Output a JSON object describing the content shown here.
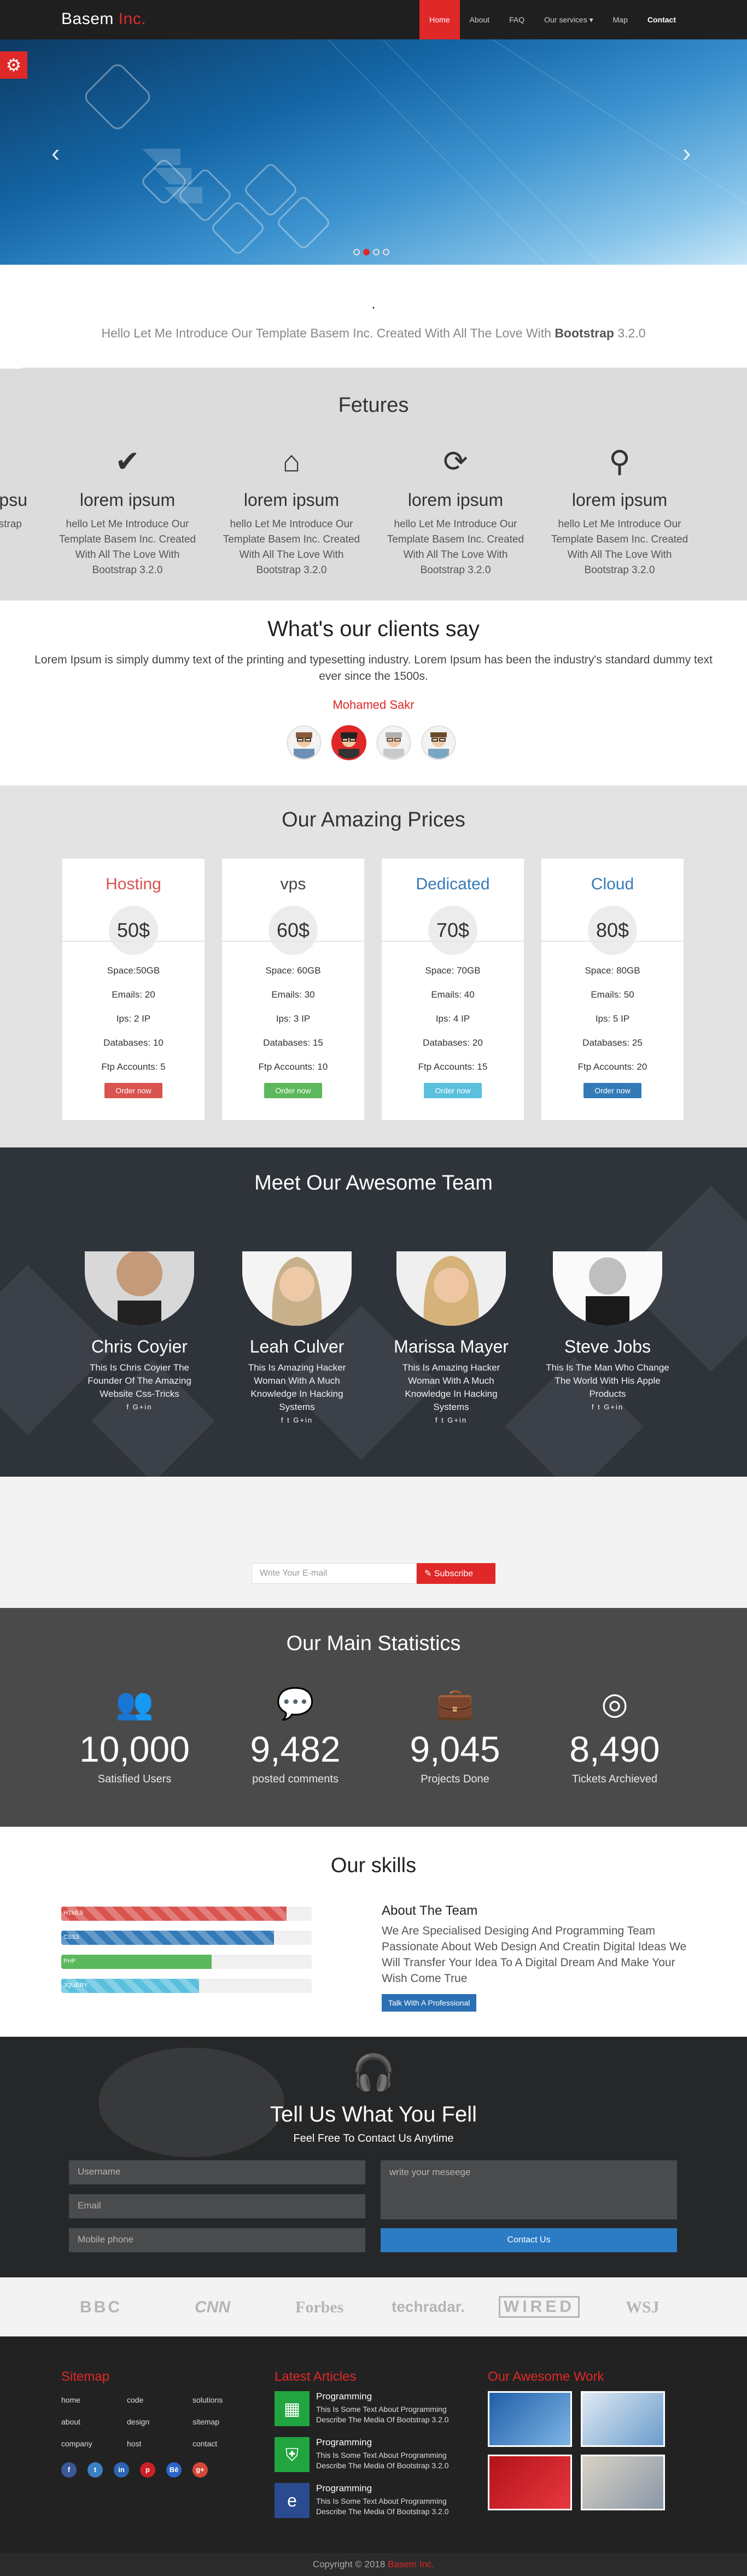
{
  "nav": {
    "brand_main": "Basem",
    "brand_accent": "Inc.",
    "items": [
      {
        "label": "Home",
        "active": true
      },
      {
        "label": "About"
      },
      {
        "label": "FAQ"
      },
      {
        "label": "Our services ▾"
      },
      {
        "label": "Map"
      },
      {
        "label": "Contact"
      }
    ]
  },
  "hero": {
    "slides": 4,
    "active_slide": 2
  },
  "intro": {
    "dot": ".",
    "text_before": "Hello Let Me Introduce Our Template Basem Inc. Created With All The Love With",
    "text_bold": "Bootstrap",
    "text_after": "3.2.0"
  },
  "features": {
    "title": "Fetures",
    "cut_title": "ipsu",
    "cut_desc": "Introdu Basem All The strap",
    "items": [
      {
        "icon": "check-icon",
        "glyph": "✔",
        "title": "lorem ipsum",
        "desc": "hello Let Me Introduce Our Template Basem Inc. Created With All The Love With Bootstrap 3.2.0"
      },
      {
        "icon": "home-icon",
        "glyph": "⌂",
        "title": "lorem ipsum",
        "desc": "hello Let Me Introduce Our Template Basem Inc. Created With All The Love With Bootstrap 3.2.0"
      },
      {
        "icon": "refresh-icon",
        "glyph": "⟳",
        "title": "lorem ipsum",
        "desc": "hello Let Me Introduce Our Template Basem Inc. Created With All The Love With Bootstrap 3.2.0"
      },
      {
        "icon": "search-icon",
        "glyph": "⚲",
        "title": "lorem ipsum",
        "desc": "hello Let Me Introduce Our Template Basem Inc. Created With All The Love With Bootstrap 3.2.0"
      }
    ]
  },
  "clients": {
    "title": "What's our clients say",
    "quote": "Lorem Ipsum is simply dummy text of the printing and typesetting industry. Lorem Ipsum has been the industry's standard dummy text ever since the 1500s.",
    "author": "Mohamed Sakr",
    "avatars": 4,
    "selected": 1
  },
  "prices": {
    "title": "Our Amazing Prices",
    "plans": [
      {
        "name": "Hosting",
        "price": "50$",
        "space": "Space:50GB",
        "emails": "Emails: 20",
        "ips": "Ips: 2 IP",
        "db": "Databases: 10",
        "ftp": "Ftp Accounts: 5",
        "button": "Order now",
        "color": "#d9534f"
      },
      {
        "name": "vps",
        "price": "60$",
        "space": "Space: 60GB",
        "emails": "Emails: 30",
        "ips": "Ips: 3 IP",
        "db": "Databases: 15",
        "ftp": "Ftp Accounts: 10",
        "button": "Order now",
        "color": "#5cb85c"
      },
      {
        "name": "Dedicated",
        "price": "70$",
        "space": "Space: 70GB",
        "emails": "Emails: 40",
        "ips": "Ips: 4 IP",
        "db": "Databases: 20",
        "ftp": "Ftp Accounts: 15",
        "button": "Order now",
        "color": "#5bc0de"
      },
      {
        "name": "Cloud",
        "price": "80$",
        "space": "Space: 80GB",
        "emails": "Emails: 50",
        "ips": "Ips: 5 IP",
        "db": "Databases: 25",
        "ftp": "Ftp Accounts: 20",
        "button": "Order now",
        "color": "#337ab7"
      }
    ],
    "title_colors": [
      "#d9534f",
      "#444444",
      "#337ab7",
      "#337ab7"
    ]
  },
  "team": {
    "title": "Meet Our Awesome Team",
    "members": [
      {
        "name": "Chris Coyier",
        "desc": "This Is Chris Coyier The Founder Of The Amazing Website Css-Tricks",
        "social": "f G+in"
      },
      {
        "name": "Leah Culver",
        "desc": "This Is Amazing Hacker Woman With A Much Knowledge In Hacking Systems",
        "social": "f t G+in"
      },
      {
        "name": "Marissa Mayer",
        "desc": "This Is Amazing Hacker Woman With A Much Knowledge In Hacking Systems",
        "social": "f t G+in"
      },
      {
        "name": "Steve Jobs",
        "desc": "This Is The Man Who Change The World With His Apple Products",
        "social": "f t G+in"
      }
    ]
  },
  "subscribe": {
    "placeholder": "Write Your E-mail",
    "button": "Subscribe"
  },
  "stats": {
    "title": "Our Main Statistics",
    "items": [
      {
        "icon": "users-icon",
        "glyph": "👥",
        "number": "10,000",
        "label": "Satisfied Users"
      },
      {
        "icon": "comments-icon",
        "glyph": "💬",
        "number": "9,482",
        "label": "posted comments"
      },
      {
        "icon": "briefcase-icon",
        "glyph": "💼",
        "number": "9,045",
        "label": "Projects Done"
      },
      {
        "icon": "lifebuoy-icon",
        "glyph": "◎",
        "number": "8,490",
        "label": "Tickets Archieved"
      }
    ]
  },
  "skills": {
    "title": "Our skills",
    "bars": [
      {
        "label": "HTML5",
        "value": 0.9,
        "color": "#d9534f"
      },
      {
        "label": "CSS3",
        "value": 0.85,
        "color": "#337ab7"
      },
      {
        "label": "PHP",
        "value": 0.6,
        "color": "#5cb85c"
      },
      {
        "label": "JQUERY",
        "value": 0.55,
        "color": "#5bc0de"
      }
    ],
    "about_title": "About The Team",
    "about_text": "We Are Specialised Desiging And Programming Team Passionate About Web Design And Creatin Digital Ideas We Will Transfer Your Idea To A Digital Dream And Make Your Wish Come True",
    "about_button": "Talk With A Professional"
  },
  "contact": {
    "icon": "headphones-icon",
    "title": "Tell Us What You Fell",
    "subtitle": "Feel Free To Contact Us Anytime",
    "username_placeholder": "Username",
    "email_placeholder": "Email",
    "phone_placeholder": "Mobile phone",
    "message_placeholder": "write your meseege",
    "button": "Contact Us"
  },
  "brands": [
    "BBC",
    "CNN",
    "Forbes",
    "techradar.",
    "WIRED",
    "WSJ"
  ],
  "footer": {
    "sitemap_title": "Sitemap",
    "sitemap_links": [
      "home",
      "code",
      "solutions",
      "about",
      "design",
      "sitemap",
      "company",
      "host",
      "contact"
    ],
    "social": [
      {
        "name": "facebook-icon",
        "glyph": "f",
        "color": "#3b5998"
      },
      {
        "name": "twitter-icon",
        "glyph": "t",
        "color": "#3b7fc4"
      },
      {
        "name": "linkedin-icon",
        "glyph": "in",
        "color": "#2d64b3"
      },
      {
        "name": "pinterest-icon",
        "glyph": "p",
        "color": "#cb2027"
      },
      {
        "name": "behance-icon",
        "glyph": "Bē",
        "color": "#2a64c9"
      },
      {
        "name": "googleplus-icon",
        "glyph": "g+",
        "color": "#d34836"
      }
    ],
    "articles_title": "Latest Articles",
    "articles": [
      {
        "icon": "calculator-icon",
        "glyph": "▦",
        "color": "#22a540",
        "title": "Programming",
        "desc": "This Is Some Text About Programming Describe The Media Of Bootstrap 3.2.0"
      },
      {
        "icon": "shield-icon",
        "glyph": "⛨",
        "color": "#22a540",
        "title": "Programming",
        "desc": "This Is Some Text About Programming Describe The Media Of Bootstrap 3.2.0"
      },
      {
        "icon": "ie-icon",
        "glyph": "e",
        "color": "#2a4b8f",
        "title": "Programming",
        "desc": "This Is Some Text About Programming Describe The Media Of Bootstrap 3.2.0"
      }
    ],
    "work_title": "Our Awesome Work",
    "copyright_before": "Copyright © 2018",
    "copyright_accent": "Basem Inc."
  }
}
